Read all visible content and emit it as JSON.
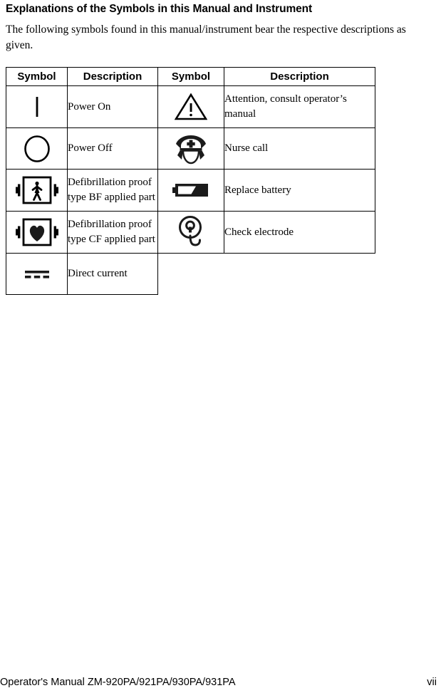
{
  "heading": "Explanations of the Symbols in this Manual and Instrument",
  "intro": "The following symbols found in this manual/instrument bear the respective descriptions as given.",
  "table": {
    "headers": {
      "symbol_left": "Symbol",
      "description_left": "Description",
      "symbol_right": "Symbol",
      "description_right": "Description"
    },
    "rows": [
      {
        "left_icon": "power-on-icon",
        "left_desc": "Power On",
        "right_icon": "attention-warning-triangle-icon",
        "right_desc": "Attention, consult operator’s manual"
      },
      {
        "left_icon": "power-off-icon",
        "left_desc": "Power Off",
        "right_icon": "nurse-call-icon",
        "right_desc": "Nurse call"
      },
      {
        "left_icon": "defibrillation-proof-bf-icon",
        "left_desc": "Defibrillation proof type BF applied part",
        "right_icon": "replace-battery-icon",
        "right_desc": "Replace battery"
      },
      {
        "left_icon": "defibrillation-proof-cf-icon",
        "left_desc": "Defibrillation proof type CF applied part",
        "right_icon": "check-electrode-icon",
        "right_desc": "Check electrode"
      },
      {
        "left_icon": "direct-current-icon",
        "left_desc": "Direct current",
        "right_icon": "",
        "right_desc": ""
      }
    ]
  },
  "footer": {
    "manual_title": "Operator's Manual  ZM-920PA/921PA/930PA/931PA",
    "page_number": "vii"
  },
  "colors": {
    "text": "#000000",
    "background": "#ffffff",
    "border": "#000000"
  }
}
